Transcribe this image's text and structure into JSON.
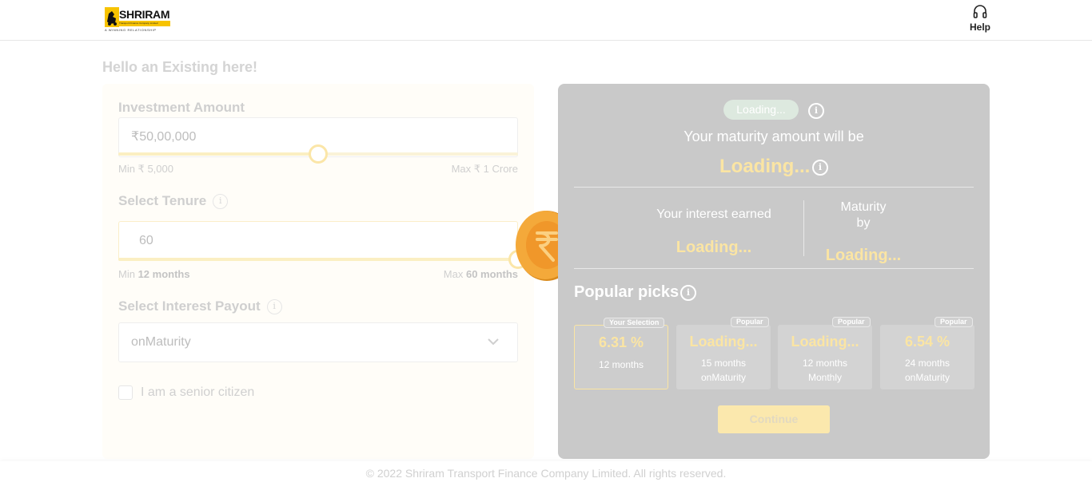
{
  "header": {
    "brand_name": "SHRIRAM",
    "brand_subline": "Transport Finance Company Limited",
    "brand_tagline": "A WINNING RELATIONSHIP",
    "help_label": "Help"
  },
  "greeting": "Hello an Existing here!",
  "form": {
    "investment": {
      "label": "Investment Amount",
      "currency_symbol": "₹",
      "value": "50,00,000",
      "slider_fraction": 0.5,
      "min_label": "Min ₹ 5,000",
      "max_label": "Max ₹ 1 Crore"
    },
    "tenure": {
      "label": "Select Tenure",
      "value": "60",
      "slider_fraction": 1.0,
      "min_prefix": "Min",
      "min_value": "12 months",
      "max_prefix": "Max",
      "max_value": "60 months"
    },
    "payout": {
      "label": "Select Interest Payout",
      "selected": "onMaturity"
    },
    "senior_citizen_label": "I am a senior citizen",
    "senior_citizen_checked": false
  },
  "summary": {
    "status_pill": "Loading...",
    "maturity_label": "Your maturity amount will be",
    "maturity_value": "Loading...",
    "interest_label": "Your interest earned",
    "interest_value": "Loading...",
    "maturity_by_line1": "Maturity",
    "maturity_by_line2": "by",
    "maturity_by_value": "Loading...",
    "popular_title": "Popular picks",
    "picks": [
      {
        "tag": "Your Selection",
        "rate": "6.31 %",
        "line1": "12 months",
        "line2": "",
        "selected": true
      },
      {
        "tag": "Popular",
        "rate": "Loading...",
        "line1": "15 months",
        "line2": "onMaturity",
        "selected": false
      },
      {
        "tag": "Popular",
        "rate": "Loading...",
        "line1": "12 months",
        "line2": "Monthly",
        "selected": false
      },
      {
        "tag": "Popular",
        "rate": "6.54 %",
        "line1": "24 months",
        "line2": "onMaturity",
        "selected": false
      }
    ],
    "continue_label": "Continue"
  },
  "footer": "© 2022 Shriram Transport Finance Company Limited. All rights reserved.",
  "colors": {
    "accent_yellow": "#f7c300",
    "loading_yellow": "#fbe5a3",
    "panel_gray": "#c9c9c9"
  },
  "icons": [
    "headset-icon",
    "info-icon",
    "chevron-down-icon",
    "rupee-coin-icon"
  ]
}
